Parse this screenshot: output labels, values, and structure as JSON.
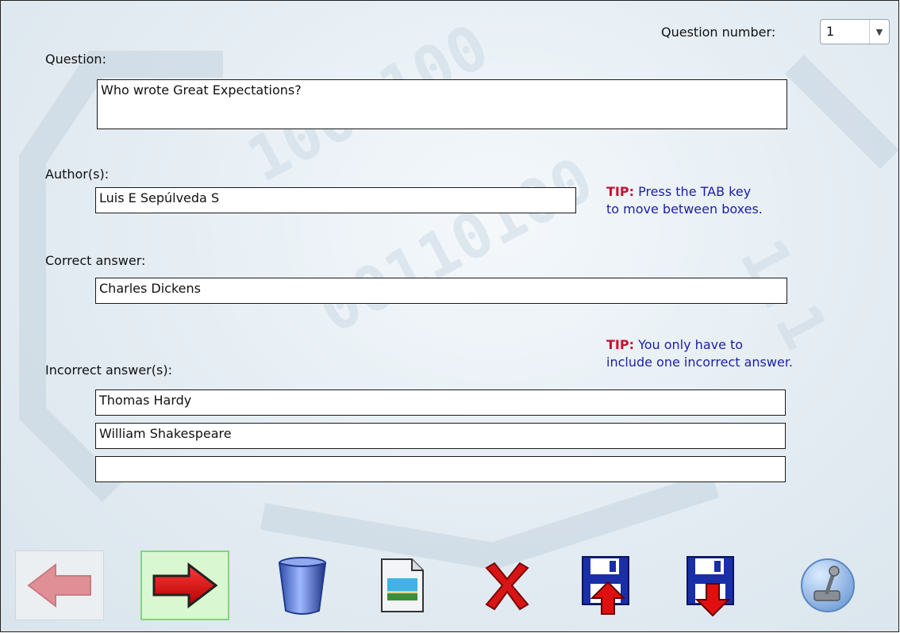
{
  "header": {
    "question_number_label": "Question number:",
    "question_number_value": "1"
  },
  "labels": {
    "question": "Question:",
    "authors": "Author(s):",
    "correct": "Correct answer:",
    "incorrect": "Incorrect answer(s):"
  },
  "fields": {
    "question": "Who wrote Great Expectations?",
    "author": "Luis E Sepúlveda S",
    "correct": "Charles Dickens",
    "incorrect": [
      "Thomas Hardy",
      "William Shakespeare",
      ""
    ]
  },
  "tips": [
    {
      "label": "TIP:",
      "line1": " Press the TAB key",
      "line2": "to move between boxes."
    },
    {
      "label": "TIP:",
      "line1": " You only have to",
      "line2": "include one incorrect answer."
    }
  ],
  "colors": {
    "tip_label": "#c8102e",
    "tip_text": "#1b1fa6",
    "active_button": "#d9f7d0"
  },
  "toolbar": [
    {
      "icon": "left-arrow-icon",
      "state": "disabled"
    },
    {
      "icon": "right-arrow-icon",
      "state": "active"
    },
    {
      "icon": "trash-icon"
    },
    {
      "icon": "image-file-icon"
    },
    {
      "icon": "delete-x-icon"
    },
    {
      "icon": "save-upload-icon"
    },
    {
      "icon": "save-download-icon"
    },
    {
      "icon": "joystick-icon"
    }
  ]
}
